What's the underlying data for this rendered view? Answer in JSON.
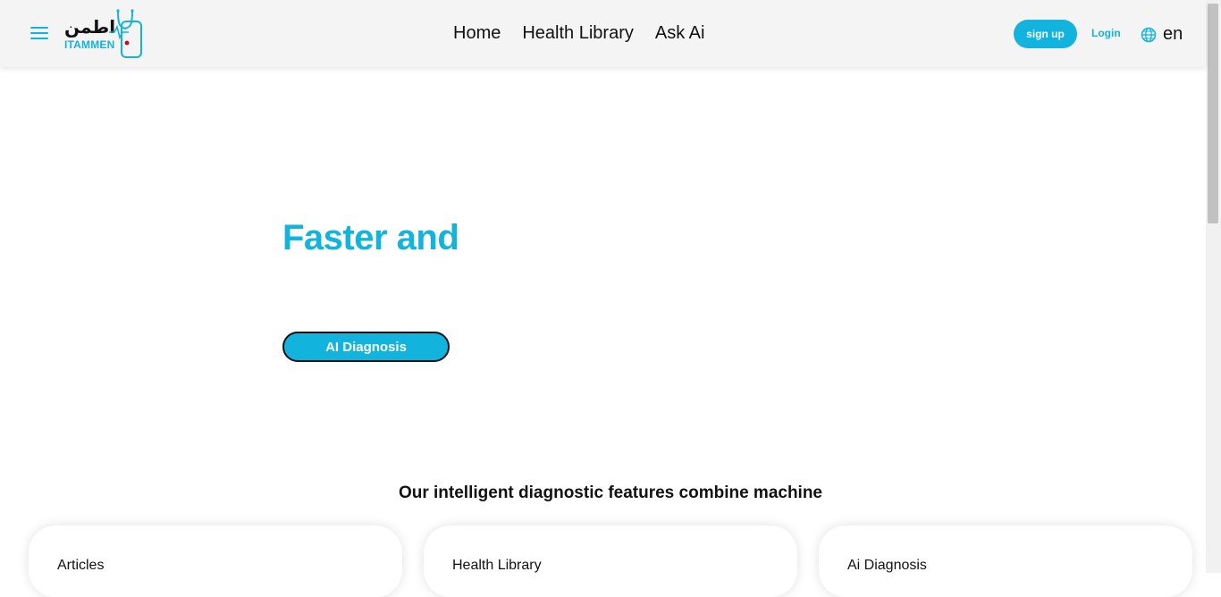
{
  "brand": {
    "logo_arabic": "اطمن",
    "logo_latin": "ITAMMEN",
    "accent_color": "#12b3dc"
  },
  "header": {
    "menu_icon": "hamburger-menu-icon",
    "nav": [
      "Home",
      "Health Library",
      "Ask Ai"
    ],
    "signup_label": "sign up",
    "login_label": "Login",
    "language_icon": "globe-icon",
    "language": "en"
  },
  "hero": {
    "title": "Faster and",
    "cta_label": "AI Diagnosis"
  },
  "features": {
    "heading": "Our intelligent diagnostic features combine machine",
    "cards": [
      "Articles",
      "Health Library",
      "Ai Diagnosis"
    ]
  }
}
